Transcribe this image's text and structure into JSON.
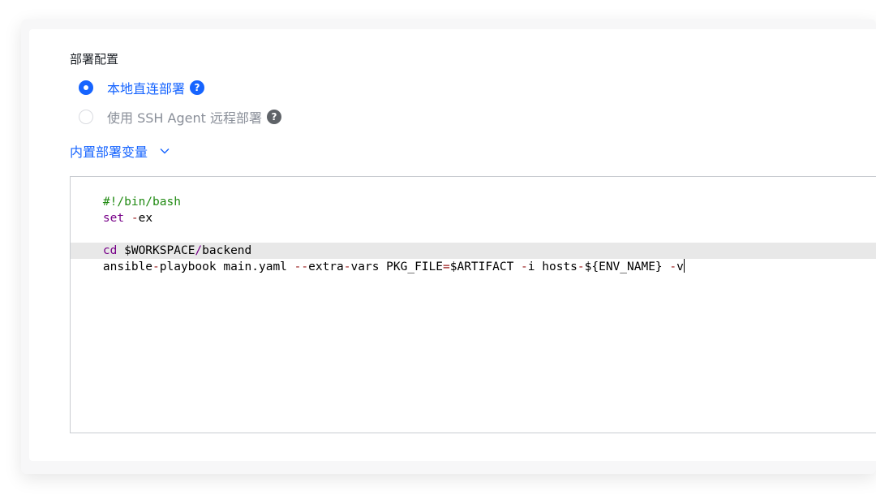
{
  "deploy": {
    "section_label": "部署配置",
    "options": [
      {
        "label": "本地直连部署",
        "selected": true,
        "help": "?"
      },
      {
        "label": "使用 SSH Agent 远程部署",
        "selected": false,
        "help": "?"
      }
    ],
    "builtin_vars_label": "内置部署变量"
  },
  "editor": {
    "lines": [
      [
        "#!/bin/bash"
      ],
      [
        "set",
        " ",
        "-",
        "ex"
      ],
      [
        ""
      ],
      [
        "cd",
        " $WORKSPACE",
        "/",
        "backend"
      ],
      [
        "ansible",
        "-",
        "playbook main.yaml ",
        "--",
        "extra",
        "-",
        "vars PKG_FILE",
        "=",
        "$ARTIFACT ",
        "-",
        "i hosts",
        "-",
        "${ENV_NAME} ",
        "-",
        "v"
      ]
    ]
  },
  "colors": {
    "accent": "#1664ff",
    "comment": "#208a12",
    "keyword": "#770088",
    "operator": "#981a1a"
  },
  "icons": {
    "radio_selected": "radio-checked-icon",
    "radio_unselected": "radio-unchecked-icon",
    "help": "question-circle-icon",
    "expand": "chevron-down-icon"
  }
}
